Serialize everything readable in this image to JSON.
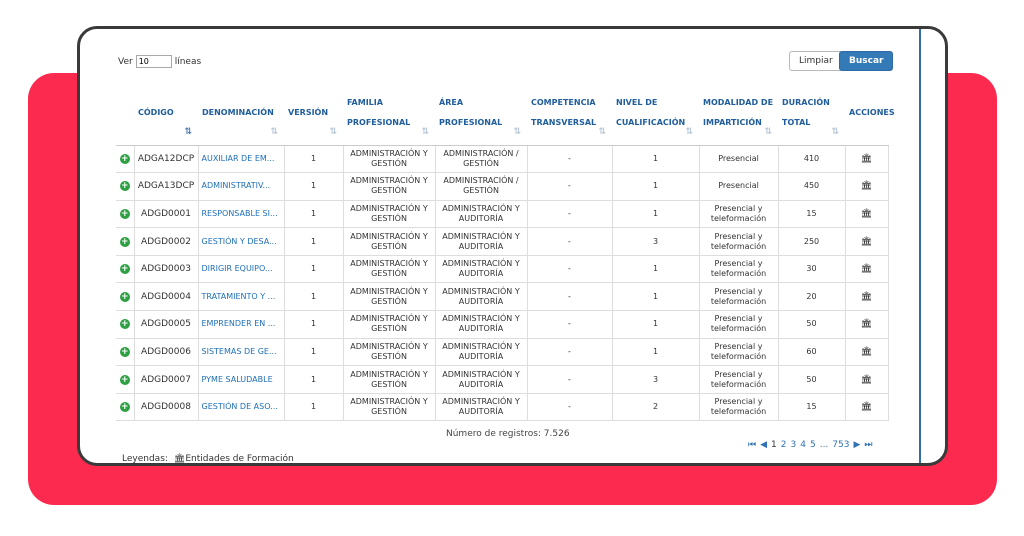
{
  "colors": {
    "accent_red": "#fc2a4e",
    "link_blue": "#1d6fb8",
    "button_blue": "#337ab7",
    "plus_green": "#2ea043"
  },
  "controls": {
    "ver_label": "Ver",
    "ver_value": "10",
    "lineas_label": "líneas",
    "limpiar": "Limpiar",
    "buscar": "Buscar"
  },
  "columns": [
    {
      "label": "CÓDIGO",
      "sort": "⇅"
    },
    {
      "label": "DENOMINACIÓN",
      "sort": "⇅"
    },
    {
      "label": "VERSIÓN",
      "sort": "⇅"
    },
    {
      "label": "FAMILIA PROFESIONAL",
      "sort": "⇅"
    },
    {
      "label": "ÁREA PROFESIONAL",
      "sort": "⇅"
    },
    {
      "label": "COMPETENCIA TRANSVERSAL",
      "sort": "⇅"
    },
    {
      "label": "NIVEL DE CUALIFICACIÓN",
      "sort": "⇅"
    },
    {
      "label": "MODALIDAD DE IMPARTICIÓN",
      "sort": "⇅"
    },
    {
      "label": "DURACIÓN TOTAL",
      "sort": "⇅"
    },
    {
      "label": "ACCIONES",
      "sort": ""
    }
  ],
  "rows": [
    {
      "codigo": "ADGA12DCP",
      "denominacion": "AUXILIAR DE EM...",
      "version": "1",
      "familia": "ADMINISTRACIÓN Y GESTIÓN",
      "area": "ADMINISTRACIÓN / GESTIÓN",
      "competencia": "-",
      "nivel": "1",
      "modalidad": "Presencial",
      "duracion": "410"
    },
    {
      "codigo": "ADGA13DCP",
      "denominacion": "ADMINISTRATIV...",
      "version": "1",
      "familia": "ADMINISTRACIÓN Y GESTIÓN",
      "area": "ADMINISTRACIÓN / GESTIÓN",
      "competencia": "-",
      "nivel": "1",
      "modalidad": "Presencial",
      "duracion": "450"
    },
    {
      "codigo": "ADGD0001",
      "denominacion": "RESPONSABLE SI...",
      "version": "1",
      "familia": "ADMINISTRACIÓN Y GESTIÓN",
      "area": "ADMINISTRACIÓN Y AUDITORÍA",
      "competencia": "-",
      "nivel": "1",
      "modalidad": "Presencial y teleformación",
      "duracion": "15"
    },
    {
      "codigo": "ADGD0002",
      "denominacion": "GESTIÓN Y DESA...",
      "version": "1",
      "familia": "ADMINISTRACIÓN Y GESTIÓN",
      "area": "ADMINISTRACIÓN Y AUDITORÍA",
      "competencia": "-",
      "nivel": "3",
      "modalidad": "Presencial y teleformación",
      "duracion": "250"
    },
    {
      "codigo": "ADGD0003",
      "denominacion": "DIRIGIR EQUIPO...",
      "version": "1",
      "familia": "ADMINISTRACIÓN Y GESTIÓN",
      "area": "ADMINISTRACIÓN Y AUDITORÍA",
      "competencia": "-",
      "nivel": "1",
      "modalidad": "Presencial y teleformación",
      "duracion": "30"
    },
    {
      "codigo": "ADGD0004",
      "denominacion": "TRATAMIENTO Y ...",
      "version": "1",
      "familia": "ADMINISTRACIÓN Y GESTIÓN",
      "area": "ADMINISTRACIÓN Y AUDITORÍA",
      "competencia": "-",
      "nivel": "1",
      "modalidad": "Presencial y teleformación",
      "duracion": "20"
    },
    {
      "codigo": "ADGD0005",
      "denominacion": "EMPRENDER EN ...",
      "version": "1",
      "familia": "ADMINISTRACIÓN Y GESTIÓN",
      "area": "ADMINISTRACIÓN Y AUDITORÍA",
      "competencia": "-",
      "nivel": "1",
      "modalidad": "Presencial y teleformación",
      "duracion": "50"
    },
    {
      "codigo": "ADGD0006",
      "denominacion": "SISTEMAS DE GE...",
      "version": "1",
      "familia": "ADMINISTRACIÓN Y GESTIÓN",
      "area": "ADMINISTRACIÓN Y AUDITORÍA",
      "competencia": "-",
      "nivel": "1",
      "modalidad": "Presencial y teleformación",
      "duracion": "60"
    },
    {
      "codigo": "ADGD0007",
      "denominacion": "PYME SALUDABLE",
      "version": "1",
      "familia": "ADMINISTRACIÓN Y GESTIÓN",
      "area": "ADMINISTRACIÓN Y AUDITORÍA",
      "competencia": "-",
      "nivel": "3",
      "modalidad": "Presencial y teleformación",
      "duracion": "50"
    },
    {
      "codigo": "ADGD0008",
      "denominacion": "GESTIÓN DE ASO...",
      "version": "1",
      "familia": "ADMINISTRACIÓN Y GESTIÓN",
      "area": "ADMINISTRACIÓN Y AUDITORÍA",
      "competencia": "-",
      "nivel": "2",
      "modalidad": "Presencial y teleformación",
      "duracion": "15"
    }
  ],
  "footer": {
    "registros": "Número de registros: 7.526",
    "pager": {
      "first": "⏮",
      "prev": "◀",
      "pages": [
        "1",
        "2",
        "3",
        "4",
        "5"
      ],
      "ellipsis": "...",
      "last_page": "753",
      "next": "▶",
      "last": "⏭"
    },
    "leyendas_label": "Leyendas:",
    "leyenda_item": "Entidades de Formación"
  }
}
